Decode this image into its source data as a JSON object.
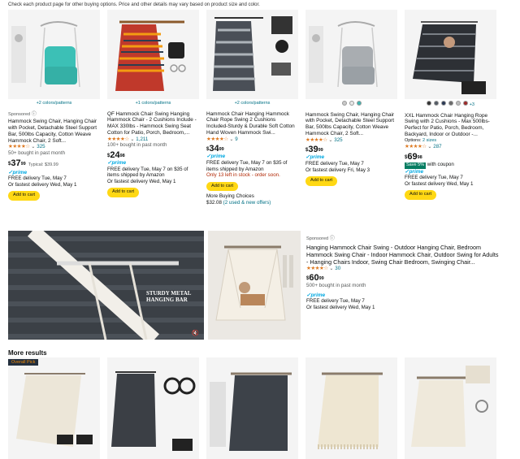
{
  "notice": "Check each product page for other buying options. Price and other details may vary based on product size and color.",
  "products": [
    {
      "colors_link": "+2 colors/patterns",
      "sponsored": "Sponsored",
      "title": "Hammock Swing Chair, Hanging Chair with Pocket, Detachable Steel Support Bar, 500lbs Capacity, Cotton Weave Hammock Chair, 2 Soft...",
      "stars": "★★★★☆",
      "reviews": "325",
      "bought": "50+ bought in past month",
      "price_whole": "37",
      "price_frac": "99",
      "typical": "Typical: $39.99",
      "prime": "✓prime",
      "delivery": "FREE delivery Tue, May 7",
      "fastest": "Or fastest delivery Wed, May 1",
      "button": "Add to cart"
    },
    {
      "colors_link": "+1 colors/patterns",
      "title": "QF Hammock Chair Swing Hanging Hammock Chair - 2 Cushions Include - MAX 330lbs - Hammock Swing Seat Cotton for Patio, Porch, Bedroom,...",
      "stars": "★★★★☆",
      "reviews": "1,211",
      "bought": "100+ bought in past month",
      "price_whole": "24",
      "price_frac": "98",
      "prime": "✓prime",
      "delivery": "FREE delivery Tue, May 7 on $35 of items shipped by Amazon",
      "fastest": "Or fastest delivery Wed, May 1",
      "button": "Add to cart"
    },
    {
      "colors_link": "+2 colors/patterns",
      "title": "Hammock Chair Hanging Hammock Chair Rope Swing 2 Cushions Included-Sturdy & Durable Soft Cotton Hand Woven Hammock Swi...",
      "stars": "★★★★☆",
      "reviews": "9",
      "price_whole": "34",
      "price_frac": "99",
      "prime": "✓prime",
      "delivery": "FREE delivery Tue, May 7 on $35 of items shipped by Amazon",
      "stock": "Only 13 left in stock - order soon.",
      "button": "Add to cart",
      "more_choices": "More Buying Choices",
      "more_price": "$32.08",
      "more_offers": "(2 used & new offers)"
    },
    {
      "title": "Hammock Swing Chair, Hanging Chair with Pocket, Detachable Steel Support Bar, 500lbs Capacity, Cotton Weave Hammock Chair, 2 Soft...",
      "stars": "★★★★☆",
      "reviews": "325",
      "price_whole": "39",
      "price_frac": "99",
      "prime": "✓prime",
      "delivery": "FREE delivery Tue, May 7",
      "fastest": "Or fastest delivery Fri, May 3",
      "button": "Add to cart",
      "swatches": [
        "#c8c8c8",
        "#e8e8e8",
        "#3fb5b1"
      ]
    },
    {
      "title": "XXL Hammock Chair Hanging Rope Swing with 2 Cushions - Max 500lbs-Perfect for Patio, Porch, Bedroom, Backyard, Indoor or Outdoor -...",
      "options": "Options:",
      "options_link": "2 sizes",
      "stars": "★★★★☆",
      "reviews": "287",
      "price_whole": "69",
      "price_frac": "98",
      "coupon_tag": "Save 5%",
      "coupon_text": "with coupon",
      "prime": "✓prime",
      "delivery": "FREE delivery Tue, May 7",
      "fastest": "Or fastest delivery Wed, May 1",
      "button": "Add to cart",
      "swatches": [
        "#333333",
        "#555d66",
        "#2b3a55",
        "#6b6b6b",
        "#bdbdbd",
        "#9e2b2b"
      ],
      "more_swatches": "+3"
    }
  ],
  "video_banner": "STURDY METAL HANGING BAR",
  "featured": {
    "sponsored": "Sponsored",
    "title": "Hanging Hammock Chair Swing - Outdoor Hanging Chair, Bedroom Hammock Swing Chair - Indoor Hammock Chair, Outdoor Swing for Adults - Hanging Chairs Indoor, Swing Chair Bedroom, Swinging Chair...",
    "stars": "★★★★☆",
    "reviews": "30",
    "price_whole": "60",
    "price_frac": "99",
    "bought": "500+ bought in past month",
    "prime": "✓prime",
    "delivery": "FREE delivery Tue, May 7",
    "fastest": "Or fastest delivery Wed, May 1"
  },
  "more_results": "More results",
  "overall_pick": "Overall Pick"
}
